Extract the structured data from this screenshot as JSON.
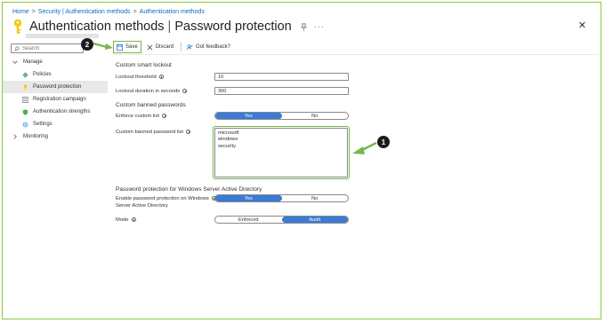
{
  "breadcrumb": [
    "Home",
    "Security | Authentication methods",
    "Authentication methods"
  ],
  "header": {
    "title_main": "Authentication methods",
    "title_sub": "Password protection",
    "more": "···",
    "close": "✕"
  },
  "sidebar": {
    "search_placeholder": "Search",
    "collapse": "«",
    "groups": [
      {
        "label": "Manage"
      },
      {
        "label": "Monitoring"
      }
    ],
    "items": [
      {
        "label": "Policies"
      },
      {
        "label": "Password protection"
      },
      {
        "label": "Registration campaign"
      },
      {
        "label": "Authentication strengths"
      },
      {
        "label": "Settings"
      }
    ]
  },
  "toolbar": {
    "save_label": "Save",
    "discard_label": "Discard",
    "feedback_label": "Got feedback?"
  },
  "callouts": [
    "1",
    "2"
  ],
  "form": {
    "section_lockout": "Custom smart lockout",
    "lockout_threshold_label": "Lockout threshold",
    "lockout_threshold_value": "10",
    "lockout_duration_label": "Lockout duration in seconds",
    "lockout_duration_value": "300",
    "section_banned": "Custom banned passwords",
    "enforce_label": "Enforce custom list",
    "enforce_yes": "Yes",
    "enforce_no": "No",
    "banned_list_label": "Custom banned password list",
    "banned_list": [
      "microsoft",
      "windows",
      "security"
    ],
    "section_windows": "Password protection for Windows Server Active Directory",
    "enable_label_1": "Enable password protection on Windows",
    "enable_label_2": "Server Active Directory",
    "enable_yes": "Yes",
    "enable_no": "No",
    "mode_label": "Mode",
    "mode_enforced": "Enforced",
    "mode_audit": "Audit"
  },
  "colors": {
    "accent_blue": "#3a7bd5",
    "link_blue": "#0f6cbd",
    "highlight_green": "#7ab648",
    "key_gold": "#f2c811"
  }
}
